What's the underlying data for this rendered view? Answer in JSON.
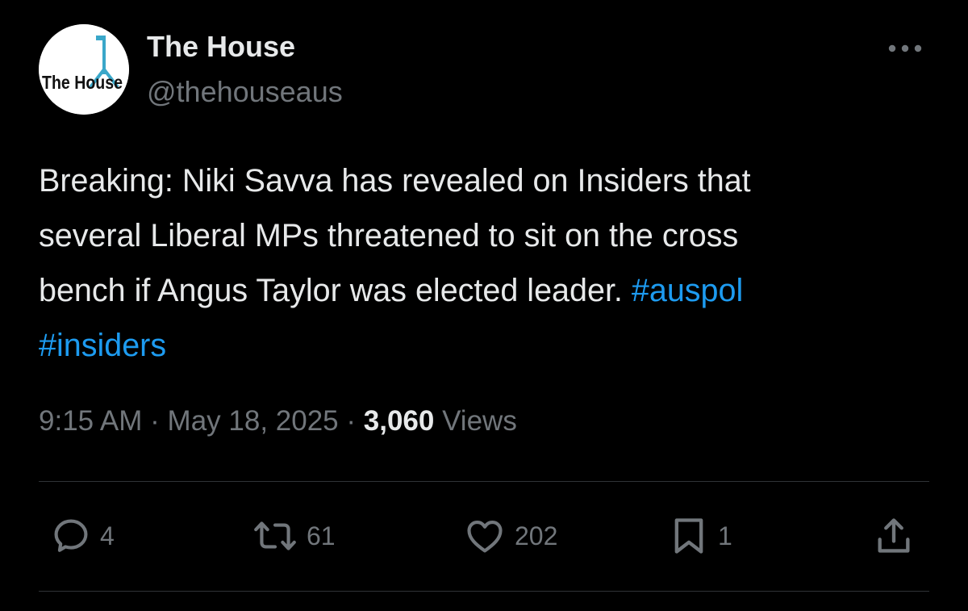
{
  "author": {
    "display_name": "The House",
    "handle": "@thehouseaus",
    "avatar_text": "The House"
  },
  "tweet": {
    "lines": [
      "Breaking: Niki Savva has revealed on Insiders that",
      "several Liberal MPs threatened to sit on the cross",
      "bench if Angus Taylor was elected leader. "
    ],
    "hashtags": [
      "#auspol",
      "#insiders"
    ]
  },
  "meta": {
    "time": "9:15 AM",
    "separator": "·",
    "date": "May 18, 2025",
    "views_count": "3,060",
    "views_label": "Views"
  },
  "actions": {
    "replies": "4",
    "reposts": "61",
    "likes": "202",
    "bookmarks": "1"
  },
  "colors": {
    "background": "#000000",
    "text": "#e7e9ea",
    "secondary": "#71767b",
    "accent": "#1d9bf0",
    "divider": "#2f3336"
  },
  "icons": [
    "more-icon",
    "reply-icon",
    "repost-icon",
    "like-icon",
    "bookmark-icon",
    "share-icon"
  ]
}
